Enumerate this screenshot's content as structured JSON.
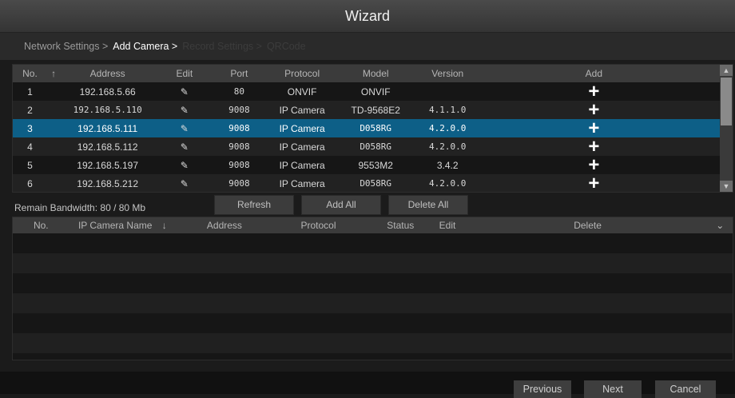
{
  "window": {
    "title": "Wizard"
  },
  "steps": {
    "network": "Network Settings >",
    "add_camera": "Add Camera >",
    "record": "Record Settings >",
    "qrcode": "QRCode"
  },
  "camera_list": {
    "columns": {
      "no": "No.",
      "sort_icon": "↑",
      "address": "Address",
      "edit": "Edit",
      "port": "Port",
      "protocol": "Protocol",
      "model": "Model",
      "version": "Version",
      "add": "Add"
    },
    "rows": [
      {
        "no": "1",
        "address": "192.168.5.66",
        "port": "80",
        "protocol": "ONVIF",
        "model": "ONVIF",
        "version": ""
      },
      {
        "no": "2",
        "address": "192.168.5.110",
        "port": "9008",
        "protocol": "IP Camera",
        "model": "TD-9568E2",
        "version": "4.1.1.0"
      },
      {
        "no": "3",
        "address": "192.168.5.111",
        "port": "9008",
        "protocol": "IP Camera",
        "model": "D058RG",
        "version": "4.2.0.0"
      },
      {
        "no": "4",
        "address": "192.168.5.112",
        "port": "9008",
        "protocol": "IP Camera",
        "model": "D058RG",
        "version": "4.2.0.0"
      },
      {
        "no": "5",
        "address": "192.168.5.197",
        "port": "9008",
        "protocol": "IP Camera",
        "model": "9553M2",
        "version": "3.4.2"
      },
      {
        "no": "6",
        "address": "192.168.5.212",
        "port": "9008",
        "protocol": "IP Camera",
        "model": "D058RG",
        "version": "4.2.0.0"
      }
    ],
    "selected_index": 2
  },
  "bandwidth": "Remain Bandwidth: 80 / 80 Mb",
  "buttons": {
    "refresh": "Refresh",
    "add_all": "Add All",
    "delete_all": "Delete All"
  },
  "added_list": {
    "columns": {
      "no": "No.",
      "name": "IP Camera Name",
      "sort_icon": "↓",
      "address": "Address",
      "protocol": "Protocol",
      "status": "Status",
      "edit": "Edit",
      "delete": "Delete"
    }
  },
  "footer": {
    "previous": "Previous",
    "next": "Next",
    "cancel": "Cancel"
  },
  "icons": {
    "edit": "pencil-icon",
    "add": "plus-icon",
    "expand": "chevron-down-icon"
  },
  "colors": {
    "selected_row": "#0d5f87"
  }
}
